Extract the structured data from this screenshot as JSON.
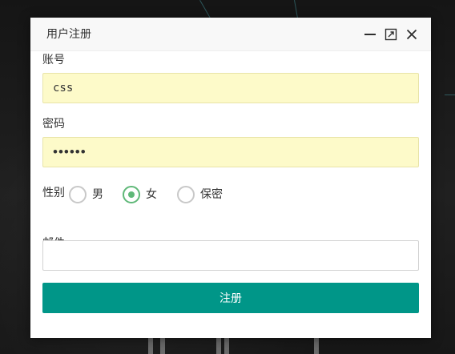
{
  "dialog": {
    "title": "用户注册",
    "controls": {
      "minimize_icon": "minimize-icon",
      "maximize_icon": "maximize-icon",
      "close_icon": "close-icon"
    }
  },
  "form": {
    "account": {
      "label": "账号",
      "value": "css"
    },
    "password": {
      "label": "密码",
      "value": "••••••"
    },
    "gender": {
      "label": "性别",
      "options": [
        {
          "label": "男",
          "checked": false
        },
        {
          "label": "女",
          "checked": true
        },
        {
          "label": "保密",
          "checked": false
        }
      ]
    },
    "email": {
      "label": "邮件",
      "value": ""
    },
    "submit_label": "注册"
  },
  "colors": {
    "accent": "#009688",
    "radio_checked": "#5fb878",
    "autofill_bg": "#fdfac9"
  }
}
